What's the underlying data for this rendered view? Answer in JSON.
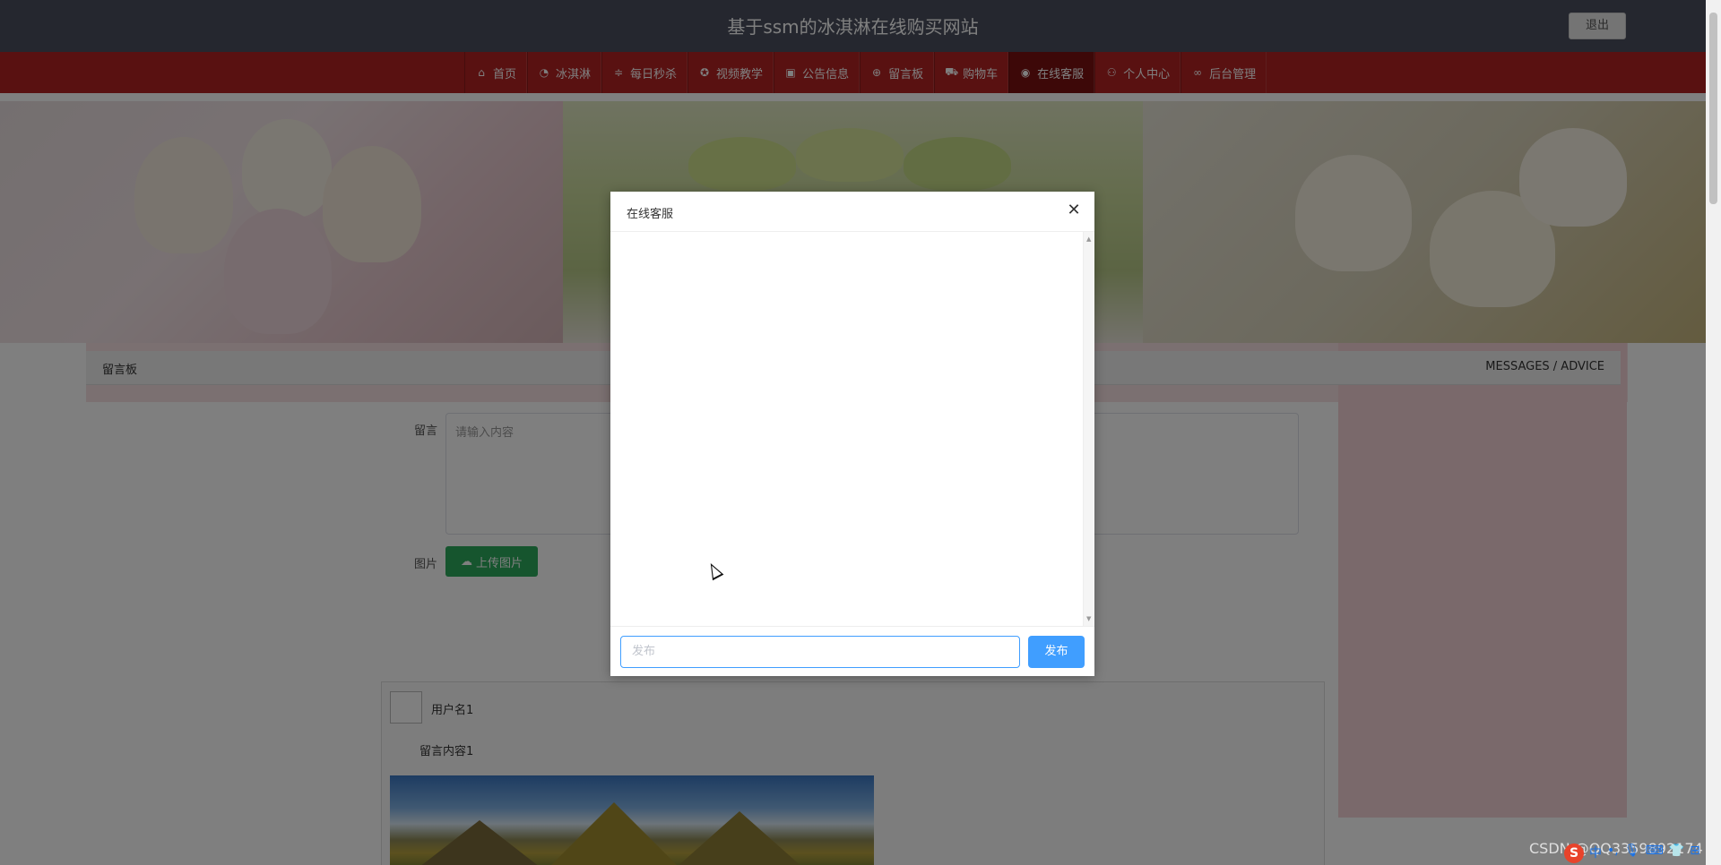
{
  "header": {
    "title": "基于ssm的冰淇淋在线购买网站",
    "logout_label": "退出"
  },
  "nav": {
    "items": [
      {
        "label": "首页",
        "icon": "home-icon"
      },
      {
        "label": "冰淇淋",
        "icon": "gauge-icon"
      },
      {
        "label": "每日秒杀",
        "icon": "sliders-icon"
      },
      {
        "label": "视频教学",
        "icon": "badge-icon"
      },
      {
        "label": "公告信息",
        "icon": "gift-icon"
      },
      {
        "label": "留言板",
        "icon": "globe-icon"
      },
      {
        "label": "购物车",
        "icon": "cart-icon"
      },
      {
        "label": "在线客服",
        "icon": "chat-icon",
        "active": true
      },
      {
        "label": "个人中心",
        "icon": "user-icon"
      },
      {
        "label": "后台管理",
        "icon": "link-icon"
      }
    ]
  },
  "breadcrumb": {
    "left": "留言板",
    "right": "MESSAGES / ADVICE"
  },
  "form": {
    "message_label": "留言",
    "message_placeholder": "请输入内容",
    "image_label": "图片",
    "upload_label": "上传图片"
  },
  "comments": [
    {
      "username": "用户名1",
      "content": "留言内容1"
    }
  ],
  "dialog": {
    "title": "在线客服",
    "input_placeholder": "发布",
    "send_label": "发布"
  },
  "watermark": "CSDN @QQ3359892174",
  "ime": {
    "label": "中"
  },
  "colors": {
    "topbar": "#4a4f5e",
    "navbar": "#b22222",
    "nav_active": "#7a1010",
    "upload_button": "#2daa5c",
    "send_button": "#409eff"
  }
}
